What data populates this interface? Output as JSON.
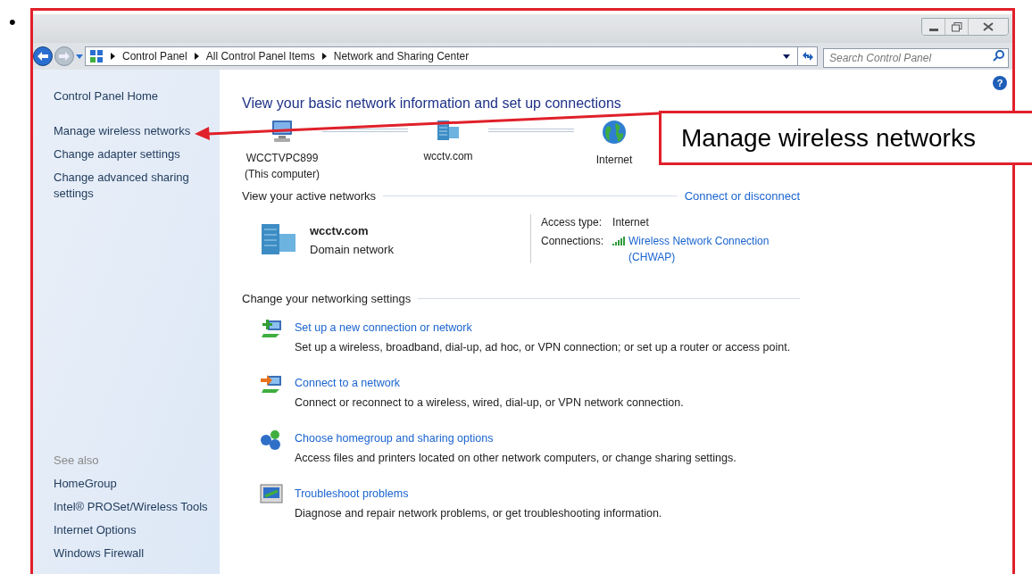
{
  "slide": {
    "bullet": "•"
  },
  "address_bar": {
    "breadcrumbs": [
      "Control Panel",
      "All Control Panel Items",
      "Network and Sharing Center"
    ],
    "search_placeholder": "Search Control Panel"
  },
  "help_glyph": "?",
  "sidebar": {
    "home": "Control Panel Home",
    "tasks": [
      "Manage wireless networks",
      "Change adapter settings",
      "Change advanced sharing settings"
    ],
    "see_also_heading": "See also",
    "see_also": [
      "HomeGroup",
      "Intel® PROSet/Wireless Tools",
      "Internet Options",
      "Windows Firewall"
    ]
  },
  "main": {
    "heading": "View your basic network information and set up connections",
    "network_map": [
      {
        "kind": "computer",
        "label": "WCCTVPC899",
        "sublabel": "(This computer)"
      },
      {
        "kind": "domain",
        "label": "wcctv.com"
      },
      {
        "kind": "internet",
        "label": "Internet"
      }
    ],
    "active_networks": {
      "heading": "View your active networks",
      "action": "Connect or disconnect",
      "name": "wcctv.com",
      "type": "Domain network",
      "access_type_label": "Access type:",
      "access_type": "Internet",
      "connections_label": "Connections:",
      "connection": "Wireless Network Connection",
      "connection_sub": "(CHWAP)"
    },
    "settings": {
      "heading": "Change your networking settings",
      "tasks": [
        {
          "kind": "new-connection",
          "title": "Set up a new connection or network",
          "description": "Set up a wireless, broadband, dial-up, ad hoc, or VPN connection; or set up a router or access point."
        },
        {
          "kind": "connect",
          "title": "Connect to a network",
          "description": "Connect or reconnect to a wireless, wired, dial-up, or VPN network connection."
        },
        {
          "kind": "homegroup",
          "title": "Choose homegroup and sharing options",
          "description": "Access files and printers located on other network computers, or change sharing settings."
        },
        {
          "kind": "troubleshoot",
          "title": "Troubleshoot problems",
          "description": "Diagnose and repair network problems, or get troubleshooting information."
        }
      ]
    }
  },
  "callout": {
    "text": "Manage wireless networks"
  }
}
